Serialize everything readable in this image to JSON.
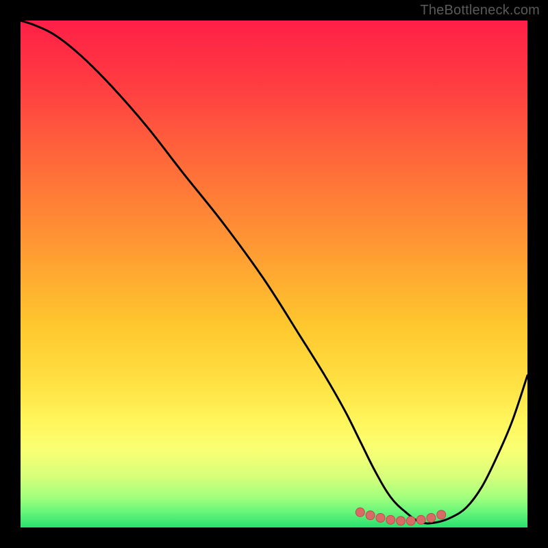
{
  "watermark": "TheBottleneck.com",
  "colors": {
    "frame_bg": "#000000",
    "watermark": "#5a5a5a",
    "curve": "#000000",
    "marker_fill": "#d96b66",
    "marker_stroke": "#b94f4a",
    "gradient_stops": [
      {
        "pct": 0,
        "color": "#ff1f47"
      },
      {
        "pct": 12,
        "color": "#ff3b42"
      },
      {
        "pct": 28,
        "color": "#ff6a3a"
      },
      {
        "pct": 45,
        "color": "#ff9a33"
      },
      {
        "pct": 60,
        "color": "#ffc72e"
      },
      {
        "pct": 72,
        "color": "#ffe244"
      },
      {
        "pct": 80,
        "color": "#fff85f"
      },
      {
        "pct": 85,
        "color": "#f8ff74"
      },
      {
        "pct": 90,
        "color": "#d6ff7a"
      },
      {
        "pct": 94,
        "color": "#a3ff7d"
      },
      {
        "pct": 97,
        "color": "#66f57a"
      },
      {
        "pct": 100,
        "color": "#2adf6f"
      }
    ]
  },
  "chart_data": {
    "type": "line",
    "title": "",
    "xlabel": "",
    "ylabel": "",
    "xlim": [
      0,
      100
    ],
    "ylim": [
      0,
      100
    ],
    "series": [
      {
        "name": "bottleneck-curve",
        "x": [
          0,
          3,
          7,
          12,
          18,
          25,
          32,
          40,
          48,
          55,
          60,
          64,
          67,
          70,
          73,
          76,
          79,
          82,
          85,
          88,
          91,
          94,
          97,
          100
        ],
        "y": [
          100,
          99,
          97,
          93,
          87,
          79,
          70,
          60,
          49,
          38,
          30,
          23,
          17,
          11,
          6,
          3,
          1,
          1,
          2,
          4,
          8,
          14,
          21,
          30
        ]
      }
    ],
    "markers": {
      "name": "highlight-range",
      "x": [
        67,
        69,
        71,
        73,
        75,
        77,
        79,
        81,
        83
      ],
      "y": [
        3.0,
        2.4,
        1.9,
        1.5,
        1.3,
        1.3,
        1.5,
        1.9,
        2.5
      ]
    }
  }
}
